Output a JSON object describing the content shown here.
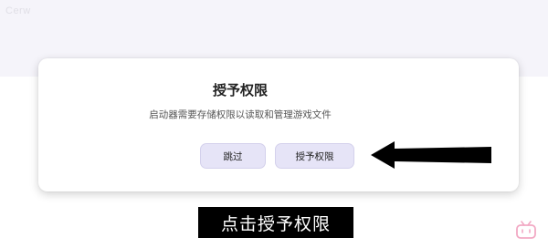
{
  "watermark": "Cerw",
  "dialog": {
    "title": "授予权限",
    "message": "启动器需要存储权限以读取和管理游戏文件",
    "skip_label": "跳过",
    "grant_label": "授予权限"
  },
  "caption": "点击授予权限",
  "colors": {
    "button_bg": "#e6e4f7",
    "caption_bg": "#000000",
    "top_band": "#f5f4fa"
  }
}
